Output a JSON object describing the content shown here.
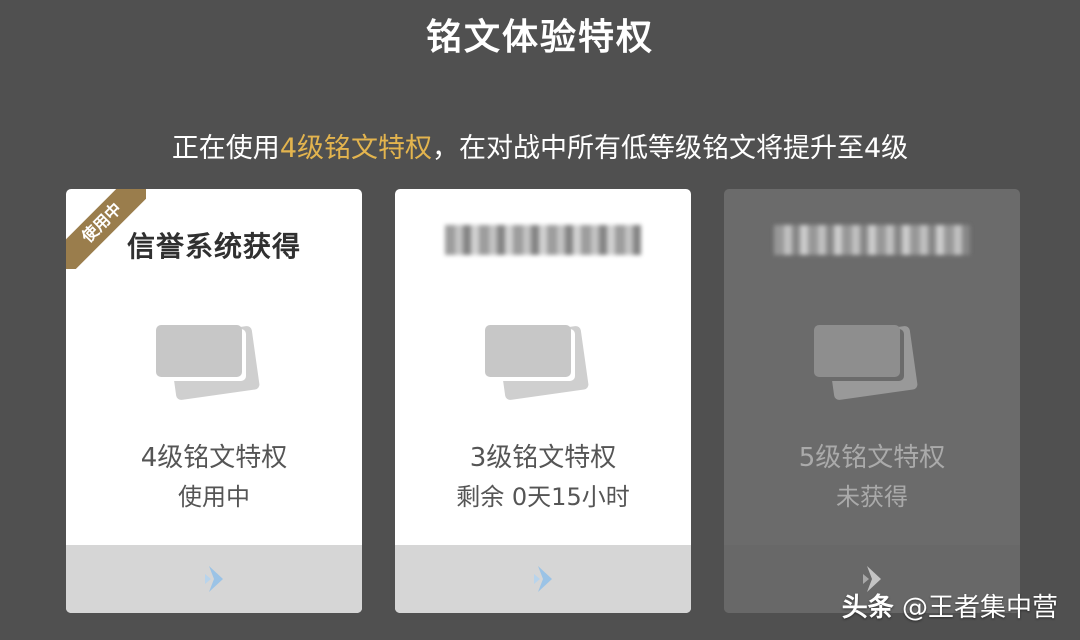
{
  "title": "铭文体验特权",
  "subtitle": {
    "prefix": "正在使用",
    "highlight": "4级铭文特权",
    "suffix": "，在对战中所有低等级铭文将提升至4级"
  },
  "colors": {
    "highlight": "#e3b44e",
    "ribbon": "#9a7d4c",
    "background": "#505050"
  },
  "cards": [
    {
      "heading": "信誉系统获得",
      "ribbon": "使用中",
      "level": "4级铭文特权",
      "status": "使用中",
      "state": "active"
    },
    {
      "heading": "",
      "level": "3级铭文特权",
      "status": "剩余 0天15小时",
      "state": "available"
    },
    {
      "heading": "",
      "level": "5级铭文特权",
      "status": "未获得",
      "state": "locked"
    }
  ],
  "icons": {
    "card": "rune-cards-icon",
    "footer": "chevron-right-icon"
  },
  "watermark": {
    "brand": "头条",
    "handle": "@王者集中营"
  }
}
